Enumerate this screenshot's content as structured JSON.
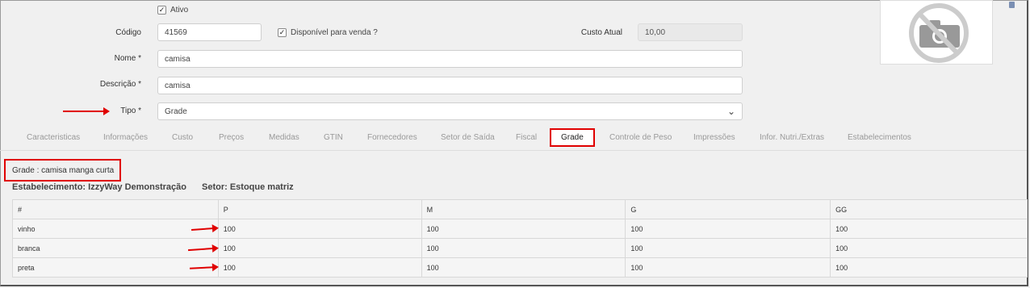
{
  "form": {
    "ativo_label": "Ativo",
    "codigo_label": "Código",
    "codigo_value": "41569",
    "disponivel_label": "Disponível para venda ?",
    "custo_label": "Custo Atual",
    "custo_value": "10,00",
    "nome_label": "Nome *",
    "nome_value": "camisa",
    "descricao_label": "Descrição *",
    "descricao_value": "camisa",
    "tipo_label": "Tipo *",
    "tipo_value": "Grade"
  },
  "tabs": [
    {
      "label": "Caracteristicas"
    },
    {
      "label": "Informações"
    },
    {
      "label": "Custo"
    },
    {
      "label": "Preços"
    },
    {
      "label": "Medidas"
    },
    {
      "label": "GTIN"
    },
    {
      "label": "Fornecedores"
    },
    {
      "label": "Setor de Saída"
    },
    {
      "label": "Fiscal"
    },
    {
      "label": "Grade"
    },
    {
      "label": "Controle de Peso"
    },
    {
      "label": "Impressões"
    },
    {
      "label": "Infor. Nutri./Extras"
    },
    {
      "label": "Estabelecimentos"
    }
  ],
  "grade": {
    "title": "Grade : camisa manga curta",
    "estabelecimento": "Estabelecimento: IzzyWay Demonstração",
    "setor": "Setor: Estoque matriz",
    "headers": [
      "#",
      "P",
      "M",
      "G",
      "GG"
    ],
    "rows": [
      {
        "name": "vinho",
        "values": [
          "100",
          "100",
          "100",
          "100"
        ]
      },
      {
        "name": "branca",
        "values": [
          "100",
          "100",
          "100",
          "100"
        ]
      },
      {
        "name": "preta",
        "values": [
          "100",
          "100",
          "100",
          "100"
        ]
      }
    ]
  },
  "colors": {
    "annotation": "#e00000",
    "background": "#f0f0f0"
  }
}
